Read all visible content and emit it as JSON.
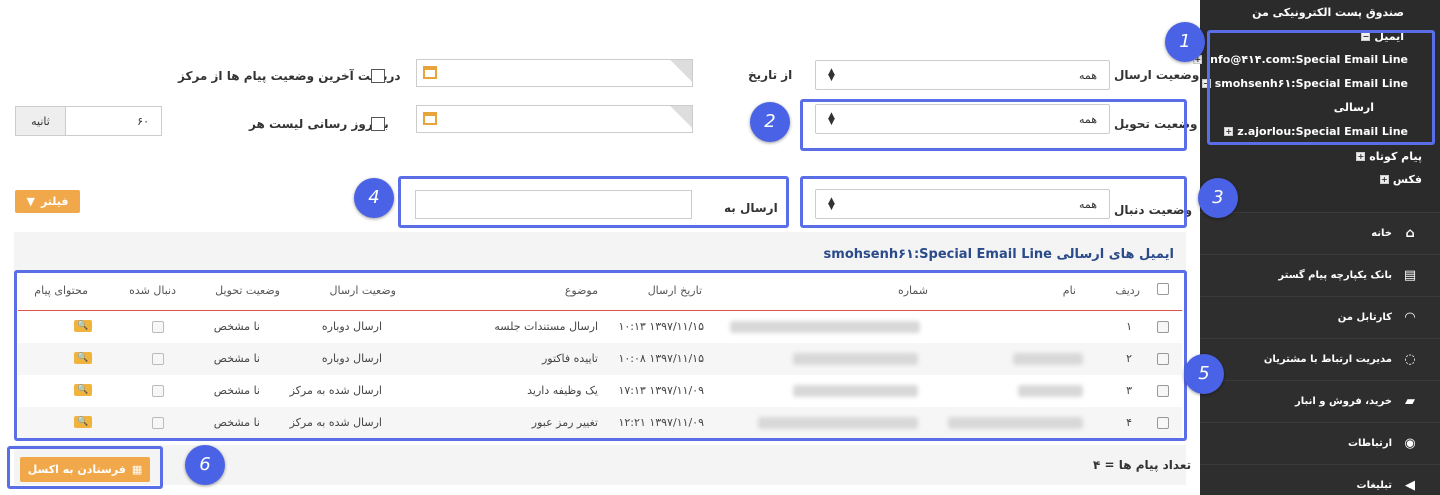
{
  "sidebar": {
    "tree": {
      "root": "صندوق پست الکترونیکی من",
      "email": "ایمیل",
      "accounts": [
        "info@۴۱۴.com:Special Email Line",
        "smohsenh۶۱:Special Email Line",
        "ارسالی",
        "z.ajorlou:Special Email Line"
      ],
      "sms": "پیام کوتاه",
      "fax": "فکس"
    },
    "menu": [
      {
        "label": "خانه",
        "icon": "home-icon"
      },
      {
        "label": "بانک یکپارچه پیام گستر",
        "icon": "bank-icon"
      },
      {
        "label": "کارتابل من",
        "icon": "dashboard-icon"
      },
      {
        "label": "مدیریت ارتباط با مشتریان",
        "icon": "crm-icon"
      },
      {
        "label": "خرید، فروش و انبار",
        "icon": "truck-icon"
      },
      {
        "label": "ارتباطات",
        "icon": "broadcast-icon"
      },
      {
        "label": "تبلیغات",
        "icon": "megaphone-icon"
      }
    ]
  },
  "filters": {
    "send_status_label": "وضعیت ارسال",
    "send_status_value": "همه",
    "delivery_status_label": "وضعیت تحویل",
    "delivery_status_value": "همه",
    "follow_status_label": "وضعیت دنبال",
    "follow_status_value": "همه",
    "from_date_label": "از تاریخ",
    "send_to_label": "ارسال به",
    "send_to_value": "",
    "last_status_label": "دریافت آخرین وضعیت پیام ها از مرکز",
    "refresh_label": "به روز رسانی لیست هر",
    "refresh_value": "۶۰",
    "seconds_label": "ثانیه",
    "filter_button": "فیلتر"
  },
  "tab_label": "ایمیل های ارسالی smohsenh۶۱:Special Email Line",
  "table": {
    "headers": [
      "ردیف",
      "نام",
      "شماره",
      "تاریخ ارسال",
      "موضوع",
      "وضعیت ارسال",
      "وضعیت تحویل",
      "دنبال شده",
      "محتوای پیام"
    ],
    "rows": [
      {
        "index": "۱",
        "date": "۱۳۹۷/۱۱/۱۵ ۱۰:۱۳",
        "subject": "ارسال مستندات جلسه",
        "send_status": "ارسال دوباره",
        "delivery": "نا مشخص"
      },
      {
        "index": "۲",
        "date": "۱۳۹۷/۱۱/۱۵ ۱۰:۰۸",
        "subject": "تاییده فاکتور",
        "send_status": "ارسال دوباره",
        "delivery": "نا مشخص"
      },
      {
        "index": "۳",
        "date": "۱۳۹۷/۱۱/۰۹ ۱۷:۱۳",
        "subject": "یک وظیفه دارید",
        "send_status": "ارسال شده به مرکز",
        "delivery": "نا مشخص"
      },
      {
        "index": "۴",
        "date": "۱۳۹۷/۱۱/۰۹ ۱۲:۲۱",
        "subject": "تغییر رمز عبور",
        "send_status": "ارسال شده به مرکز",
        "delivery": "نا مشخص"
      }
    ]
  },
  "footer": {
    "count_label": "تعداد پیام ها = ۴",
    "excel_button": "فرستادن به اکسل"
  },
  "badges": [
    "1",
    "2",
    "3",
    "4",
    "5",
    "6"
  ],
  "colors": {
    "accent": "#5a6ee8",
    "orange": "#f0a84a",
    "sidebar": "#2e2e2e"
  }
}
